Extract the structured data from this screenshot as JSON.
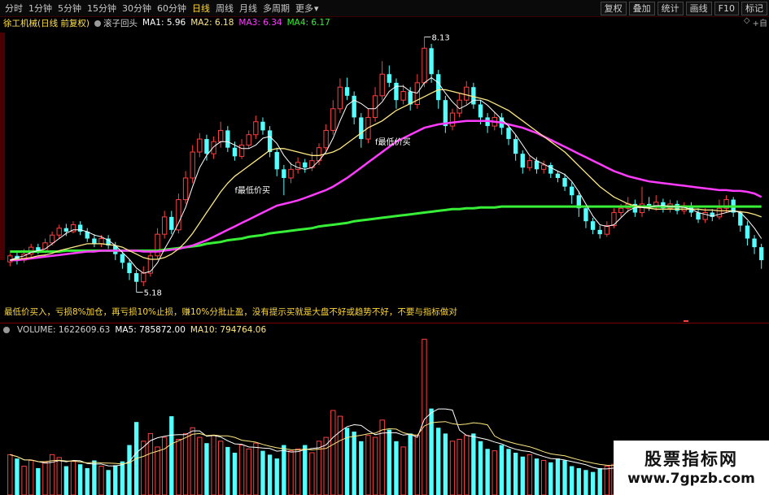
{
  "toolbar": {
    "periods": [
      {
        "label": "分时",
        "active": false
      },
      {
        "label": "1分钟",
        "active": false
      },
      {
        "label": "5分钟",
        "active": false
      },
      {
        "label": "15分钟",
        "active": false
      },
      {
        "label": "30分钟",
        "active": false
      },
      {
        "label": "60分钟",
        "active": false
      },
      {
        "label": "日线",
        "active": true
      },
      {
        "label": "周线",
        "active": false
      },
      {
        "label": "月线",
        "active": false
      },
      {
        "label": "多周期",
        "active": false
      },
      {
        "label": "更多",
        "active": false
      }
    ],
    "more_arrow": "▾",
    "tools": [
      "复权",
      "叠加",
      "统计",
      "画线",
      "F10",
      "标记"
    ],
    "right_icons": [
      "◇",
      "+自"
    ]
  },
  "legend": {
    "stock": "徐工机械(日线 前复权)",
    "indicator": "滚子回头",
    "ma1": "MA1: 5.96",
    "ma2": "MA2: 6.18",
    "ma3": "MA3: 6.34",
    "ma4": "MA4: 6.17"
  },
  "colors": {
    "ma1": "#ffffff",
    "ma2": "#ffe882",
    "ma3": "#ff3cff",
    "ma4": "#37ef37",
    "up": "#ff4040",
    "down": "#54ffff",
    "legend_yellow": "#ffd83a"
  },
  "annotations": {
    "high_label": "8.13",
    "low_label": "5.18",
    "buy1": "f最低价买",
    "buy2": "f最低价买"
  },
  "hint": "最低价买入，亏损8%加仓，再亏损10%止损，赚10%分批止盈，没有提示买就是大盘不好或趋势不好，不要与指标做对",
  "volume": {
    "title": "VOLUME: 1622609.63",
    "ma5": "MA5: 785872.00",
    "ma10": "MA10: 794764.06"
  },
  "watermark": {
    "title": "股票指标网",
    "url": "www.7gpzb.com"
  },
  "chart_data": {
    "type": "candlestick",
    "low": 5.18,
    "high": 8.13,
    "candles": [
      [
        5.53,
        5.6,
        5.48,
        5.63
      ],
      [
        5.6,
        5.55,
        5.5,
        5.66
      ],
      [
        5.55,
        5.62,
        5.52,
        5.68
      ],
      [
        5.62,
        5.7,
        5.58,
        5.74
      ],
      [
        5.7,
        5.66,
        5.62,
        5.74
      ],
      [
        5.66,
        5.75,
        5.63,
        5.8
      ],
      [
        5.75,
        5.84,
        5.72,
        5.88
      ],
      [
        5.84,
        5.92,
        5.8,
        5.96
      ],
      [
        5.92,
        5.88,
        5.83,
        5.97
      ],
      [
        5.88,
        5.96,
        5.86,
        6.0
      ],
      [
        5.96,
        5.88,
        5.84,
        6.0
      ],
      [
        5.88,
        5.8,
        5.76,
        5.92
      ],
      [
        5.8,
        5.74,
        5.7,
        5.85
      ],
      [
        5.74,
        5.8,
        5.7,
        5.84
      ],
      [
        5.8,
        5.72,
        5.68,
        5.84
      ],
      [
        5.72,
        5.62,
        5.55,
        5.76
      ],
      [
        5.62,
        5.52,
        5.45,
        5.66
      ],
      [
        5.52,
        5.4,
        5.32,
        5.56
      ],
      [
        5.4,
        5.3,
        5.18,
        5.44
      ],
      [
        5.3,
        5.4,
        5.25,
        5.48
      ],
      [
        5.4,
        5.6,
        5.36,
        5.66
      ],
      [
        5.6,
        5.85,
        5.56,
        5.92
      ],
      [
        5.85,
        6.05,
        5.8,
        6.12
      ],
      [
        6.05,
        5.9,
        5.85,
        6.12
      ],
      [
        5.9,
        6.25,
        5.86,
        6.32
      ],
      [
        6.25,
        6.5,
        6.2,
        6.58
      ],
      [
        6.5,
        6.8,
        6.44,
        6.88
      ],
      [
        6.8,
        6.95,
        6.74,
        7.02
      ],
      [
        6.95,
        6.78,
        6.7,
        7.0
      ],
      [
        6.78,
        6.92,
        6.72,
        6.98
      ],
      [
        6.92,
        7.05,
        6.85,
        7.15
      ],
      [
        7.05,
        6.85,
        6.8,
        7.1
      ],
      [
        6.85,
        6.75,
        6.7,
        6.92
      ],
      [
        6.75,
        6.88,
        6.72,
        6.95
      ],
      [
        6.88,
        7.0,
        6.84,
        7.05
      ],
      [
        7.0,
        7.15,
        6.95,
        7.22
      ],
      [
        7.15,
        7.05,
        7.0,
        7.2
      ],
      [
        7.05,
        6.8,
        6.74,
        7.1
      ],
      [
        6.8,
        6.6,
        6.52,
        6.85
      ],
      [
        6.6,
        6.5,
        6.3,
        6.65
      ],
      [
        6.5,
        6.6,
        6.44,
        6.68
      ],
      [
        6.6,
        6.68,
        6.55,
        6.74
      ],
      [
        6.68,
        6.62,
        6.56,
        6.72
      ],
      [
        6.62,
        6.7,
        6.58,
        6.8
      ],
      [
        6.7,
        6.85,
        6.65,
        6.9
      ],
      [
        6.85,
        7.05,
        6.8,
        7.12
      ],
      [
        7.05,
        7.3,
        7.0,
        7.4
      ],
      [
        7.3,
        7.55,
        7.25,
        7.65
      ],
      [
        7.55,
        7.45,
        7.4,
        7.66
      ],
      [
        7.45,
        7.2,
        7.12,
        7.5
      ],
      [
        7.2,
        6.95,
        6.85,
        7.25
      ],
      [
        6.95,
        7.2,
        6.9,
        7.3
      ],
      [
        7.2,
        7.45,
        7.15,
        7.55
      ],
      [
        7.45,
        7.7,
        7.4,
        7.85
      ],
      [
        7.7,
        7.6,
        7.55,
        7.8
      ],
      [
        7.6,
        7.4,
        7.3,
        7.65
      ],
      [
        7.4,
        7.5,
        7.35,
        7.58
      ],
      [
        7.5,
        7.35,
        7.28,
        7.55
      ],
      [
        7.35,
        7.6,
        7.3,
        7.7
      ],
      [
        7.6,
        8.0,
        7.55,
        8.13
      ],
      [
        8.0,
        7.7,
        7.6,
        8.05
      ],
      [
        7.7,
        7.4,
        7.3,
        7.75
      ],
      [
        7.4,
        7.1,
        7.02,
        7.45
      ],
      [
        7.1,
        7.25,
        7.05,
        7.3
      ],
      [
        7.25,
        7.4,
        7.2,
        7.48
      ],
      [
        7.4,
        7.55,
        7.35,
        7.62
      ],
      [
        7.55,
        7.35,
        7.3,
        7.6
      ],
      [
        7.35,
        7.2,
        7.12,
        7.4
      ],
      [
        7.2,
        7.1,
        7.02,
        7.25
      ],
      [
        7.1,
        7.2,
        7.05,
        7.26
      ],
      [
        7.2,
        7.08,
        7.0,
        7.25
      ],
      [
        7.08,
        6.95,
        6.88,
        7.12
      ],
      [
        6.95,
        6.78,
        6.7,
        7.0
      ],
      [
        6.78,
        6.62,
        6.55,
        6.82
      ],
      [
        6.62,
        6.7,
        6.58,
        6.75
      ],
      [
        6.7,
        6.6,
        6.55,
        6.74
      ],
      [
        6.6,
        6.65,
        6.55,
        6.7
      ],
      [
        6.65,
        6.55,
        6.5,
        6.68
      ],
      [
        6.55,
        6.5,
        6.45,
        6.58
      ],
      [
        6.5,
        6.4,
        6.35,
        6.55
      ],
      [
        6.4,
        6.3,
        6.2,
        6.45
      ],
      [
        6.3,
        6.15,
        6.05,
        6.35
      ],
      [
        6.15,
        6.0,
        5.92,
        6.18
      ],
      [
        6.0,
        5.9,
        5.85,
        6.04
      ],
      [
        5.9,
        5.85,
        5.8,
        5.95
      ],
      [
        5.85,
        5.95,
        5.82,
        6.0
      ],
      [
        5.95,
        6.1,
        5.92,
        6.15
      ],
      [
        6.1,
        6.15,
        6.05,
        6.2
      ],
      [
        6.15,
        6.2,
        6.1,
        6.28
      ],
      [
        6.2,
        6.1,
        6.05,
        6.25
      ],
      [
        6.1,
        6.2,
        6.05,
        6.4
      ],
      [
        6.2,
        6.18,
        6.12,
        6.28
      ],
      [
        6.18,
        6.22,
        6.12,
        6.3
      ],
      [
        6.22,
        6.15,
        6.1,
        6.26
      ],
      [
        6.15,
        6.2,
        6.1,
        6.25
      ],
      [
        6.2,
        6.12,
        6.08,
        6.24
      ],
      [
        6.12,
        6.18,
        6.08,
        6.22
      ],
      [
        6.18,
        6.1,
        6.05,
        6.22
      ],
      [
        6.1,
        6.02,
        5.98,
        6.15
      ],
      [
        6.02,
        6.1,
        5.98,
        6.15
      ],
      [
        6.1,
        6.05,
        6.0,
        6.14
      ],
      [
        6.05,
        6.15,
        6.02,
        6.25
      ],
      [
        6.15,
        6.25,
        6.1,
        6.3
      ],
      [
        6.25,
        6.1,
        6.05,
        6.28
      ],
      [
        6.1,
        5.95,
        5.88,
        6.12
      ],
      [
        5.95,
        5.8,
        5.72,
        6.0
      ],
      [
        5.8,
        5.7,
        5.62,
        5.84
      ],
      [
        5.7,
        5.55,
        5.45,
        5.74
      ]
    ],
    "ma": {
      "ma1": [
        5.55,
        5.58,
        5.6,
        5.64,
        5.66,
        5.68,
        5.74,
        5.8,
        5.86,
        5.9,
        5.9,
        5.88,
        5.84,
        5.82,
        5.78,
        5.72,
        5.64,
        5.56,
        5.46,
        5.4,
        5.42,
        5.52,
        5.68,
        5.82,
        5.98,
        6.16,
        6.4,
        6.62,
        6.76,
        6.86,
        6.92,
        6.92,
        6.88,
        6.84,
        6.84,
        6.88,
        6.96,
        6.98,
        6.9,
        6.76,
        6.66,
        6.62,
        6.6,
        6.62,
        6.7,
        6.8,
        6.96,
        7.16,
        7.34,
        7.4,
        7.36,
        7.3,
        7.3,
        7.38,
        7.5,
        7.56,
        7.56,
        7.5,
        7.48,
        7.6,
        7.66,
        7.6,
        7.48,
        7.38,
        7.3,
        7.34,
        7.4,
        7.4,
        7.34,
        7.26,
        7.18,
        7.1,
        7.0,
        6.88,
        6.76,
        6.7,
        6.66,
        6.62,
        6.58,
        6.54,
        6.46,
        6.34,
        6.2,
        6.06,
        5.96,
        5.94,
        5.96,
        6.04,
        6.12,
        6.16,
        6.16,
        6.16,
        6.18,
        6.18,
        6.17,
        6.17,
        6.16,
        6.14,
        6.1,
        6.08,
        6.06,
        6.08,
        6.1,
        6.12,
        6.1,
        6.02,
        5.92,
        5.8
      ],
      "ma2": [
        5.55,
        5.56,
        5.57,
        5.58,
        5.6,
        5.61,
        5.63,
        5.66,
        5.68,
        5.7,
        5.72,
        5.74,
        5.74,
        5.74,
        5.73,
        5.72,
        5.7,
        5.66,
        5.62,
        5.58,
        5.56,
        5.56,
        5.58,
        5.62,
        5.68,
        5.76,
        5.86,
        5.98,
        6.1,
        6.22,
        6.34,
        6.44,
        6.52,
        6.58,
        6.64,
        6.7,
        6.76,
        6.82,
        6.84,
        6.84,
        6.82,
        6.8,
        6.78,
        6.76,
        6.76,
        6.78,
        6.8,
        6.84,
        6.9,
        6.96,
        7.02,
        7.08,
        7.12,
        7.16,
        7.22,
        7.28,
        7.32,
        7.36,
        7.4,
        7.44,
        7.48,
        7.52,
        7.52,
        7.5,
        7.48,
        7.46,
        7.44,
        7.42,
        7.4,
        7.36,
        7.32,
        7.28,
        7.22,
        7.16,
        7.1,
        7.04,
        6.98,
        6.92,
        6.86,
        6.8,
        6.72,
        6.64,
        6.56,
        6.48,
        6.4,
        6.34,
        6.28,
        6.24,
        6.2,
        6.18,
        6.16,
        6.15,
        6.14,
        6.14,
        6.14,
        6.14,
        6.14,
        6.14,
        6.14,
        6.13,
        6.13,
        6.12,
        6.12,
        6.12,
        6.11,
        6.1,
        6.08,
        6.05
      ],
      "ma3": [
        5.55,
        5.55,
        5.56,
        5.57,
        5.58,
        5.59,
        5.6,
        5.61,
        5.62,
        5.63,
        5.64,
        5.65,
        5.65,
        5.66,
        5.66,
        5.66,
        5.66,
        5.66,
        5.66,
        5.65,
        5.65,
        5.65,
        5.66,
        5.67,
        5.68,
        5.7,
        5.72,
        5.75,
        5.78,
        5.82,
        5.86,
        5.9,
        5.94,
        5.98,
        6.02,
        6.06,
        6.1,
        6.14,
        6.18,
        6.2,
        6.22,
        6.24,
        6.27,
        6.3,
        6.33,
        6.36,
        6.4,
        6.45,
        6.5,
        6.56,
        6.62,
        6.68,
        6.74,
        6.8,
        6.86,
        6.92,
        6.96,
        7.0,
        7.04,
        7.08,
        7.1,
        7.12,
        7.13,
        7.14,
        7.15,
        7.16,
        7.16,
        7.16,
        7.16,
        7.15,
        7.14,
        7.12,
        7.1,
        7.08,
        7.05,
        7.02,
        6.98,
        6.94,
        6.9,
        6.86,
        6.82,
        6.78,
        6.74,
        6.7,
        6.66,
        6.62,
        6.58,
        6.55,
        6.52,
        6.5,
        6.48,
        6.46,
        6.45,
        6.44,
        6.43,
        6.42,
        6.41,
        6.4,
        6.39,
        6.38,
        6.37,
        6.36,
        6.36,
        6.35,
        6.35,
        6.34,
        6.32,
        6.28
      ],
      "ma4": [
        5.65,
        5.65,
        5.65,
        5.65,
        5.65,
        5.65,
        5.65,
        5.65,
        5.66,
        5.66,
        5.66,
        5.66,
        5.66,
        5.66,
        5.66,
        5.66,
        5.66,
        5.66,
        5.66,
        5.66,
        5.66,
        5.66,
        5.67,
        5.68,
        5.69,
        5.7,
        5.71,
        5.72,
        5.74,
        5.75,
        5.76,
        5.78,
        5.79,
        5.8,
        5.82,
        5.83,
        5.84,
        5.86,
        5.87,
        5.88,
        5.89,
        5.9,
        5.91,
        5.92,
        5.94,
        5.95,
        5.96,
        5.97,
        5.98,
        6.0,
        6.01,
        6.02,
        6.03,
        6.04,
        6.05,
        6.06,
        6.07,
        6.08,
        6.09,
        6.1,
        6.11,
        6.12,
        6.13,
        6.14,
        6.14,
        6.15,
        6.15,
        6.16,
        6.16,
        6.16,
        6.17,
        6.17,
        6.17,
        6.17,
        6.17,
        6.17,
        6.17,
        6.17,
        6.17,
        6.17,
        6.17,
        6.17,
        6.17,
        6.17,
        6.17,
        6.17,
        6.17,
        6.17,
        6.17,
        6.17,
        6.17,
        6.17,
        6.17,
        6.17,
        6.17,
        6.17,
        6.17,
        6.17,
        6.17,
        6.17,
        6.17,
        6.17,
        6.17,
        6.17,
        6.17,
        6.17,
        6.17,
        6.17
      ]
    },
    "volume_values": [
      420,
      380,
      300,
      360,
      280,
      340,
      420,
      390,
      300,
      350,
      320,
      280,
      360,
      300,
      260,
      310,
      350,
      520,
      760,
      560,
      640,
      500,
      600,
      820,
      580,
      640,
      700,
      600,
      540,
      620,
      560,
      500,
      440,
      520,
      480,
      540,
      460,
      420,
      380,
      520,
      460,
      480,
      520,
      440,
      560,
      600,
      880,
      820,
      700,
      660,
      560,
      620,
      600,
      780,
      680,
      560,
      500,
      640,
      620,
      1622,
      900,
      700,
      640,
      560,
      580,
      620,
      640,
      560,
      480,
      460,
      520,
      480,
      440,
      400,
      420,
      380,
      360,
      340,
      380,
      360,
      300,
      280,
      260,
      240,
      280,
      300,
      320,
      300,
      280,
      300,
      260,
      280,
      300,
      280,
      260,
      300,
      280,
      260,
      240,
      300,
      320,
      380,
      360,
      420,
      440,
      400,
      360,
      340
    ]
  }
}
